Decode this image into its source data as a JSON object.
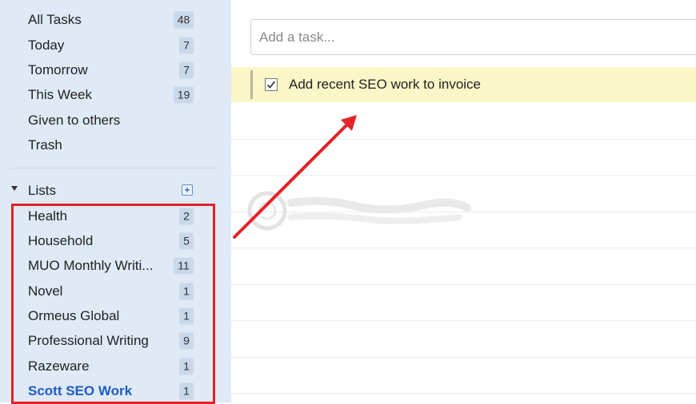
{
  "sidebar": {
    "smart_lists": [
      {
        "label": "All Tasks",
        "count": "48"
      },
      {
        "label": "Today",
        "count": "7"
      },
      {
        "label": "Tomorrow",
        "count": "7"
      },
      {
        "label": "This Week",
        "count": "19"
      },
      {
        "label": "Given to others",
        "count": ""
      },
      {
        "label": "Trash",
        "count": ""
      }
    ],
    "lists_header": "Lists",
    "lists": [
      {
        "label": "Health",
        "count": "2"
      },
      {
        "label": "Household",
        "count": "5"
      },
      {
        "label": "MUO Monthly Writi...",
        "count": "11"
      },
      {
        "label": "Novel",
        "count": "1"
      },
      {
        "label": "Ormeus Global",
        "count": "1"
      },
      {
        "label": "Professional Writing",
        "count": "9"
      },
      {
        "label": "Razeware",
        "count": "1"
      },
      {
        "label": "Scott SEO Work",
        "count": "1"
      }
    ],
    "active_list": "Scott SEO Work"
  },
  "main": {
    "add_task_placeholder": "Add a task...",
    "tasks": [
      {
        "title": "Add recent SEO work to invoice",
        "checked": true
      }
    ]
  },
  "colors": {
    "sidebar_bg": "#dfeaf6",
    "highlight_red": "#e2232a",
    "task_row_bg": "#fbf7c8",
    "active_text": "#1f5bc4"
  },
  "icons": [
    "plus-icon",
    "checkbox-checked-icon",
    "collapse-arrow-icon"
  ]
}
